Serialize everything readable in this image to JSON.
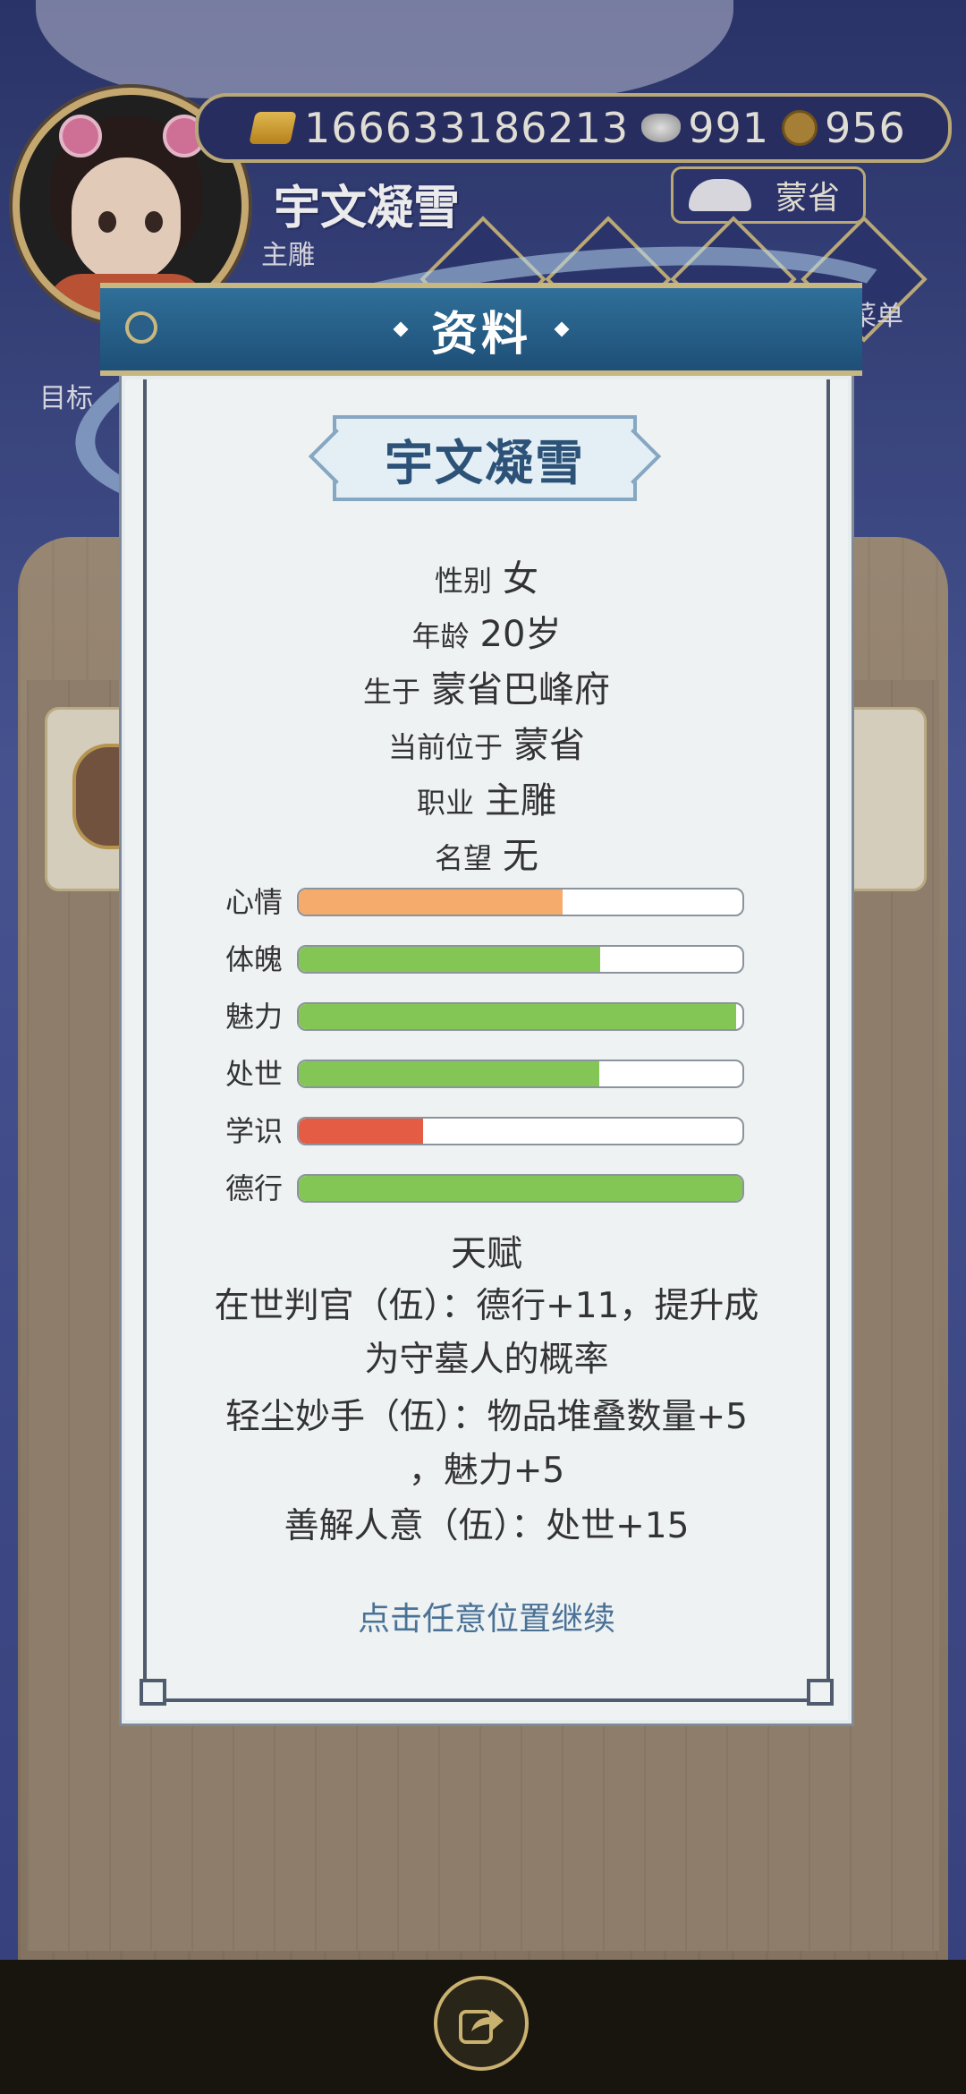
{
  "hud": {
    "gold": "166633186213",
    "silver": "991",
    "copper": "956",
    "name": "宇文凝雪",
    "job": "主雕",
    "location": "蒙省",
    "menu_label": "菜单",
    "target_label": "目标"
  },
  "panel": {
    "title": "资料",
    "name": "宇文凝雪",
    "info": [
      {
        "k": "性别",
        "v": "女"
      },
      {
        "k": "年龄",
        "v": "20岁"
      },
      {
        "k": "生于",
        "v": "蒙省巴峰府"
      },
      {
        "k": "当前位于",
        "v": "蒙省"
      },
      {
        "k": "职业",
        "v": "主雕"
      },
      {
        "k": "名望",
        "v": "无"
      }
    ],
    "stats": [
      {
        "label": "心情",
        "fraction": 0.595,
        "color": "#f4ab6c"
      },
      {
        "label": "体魄",
        "fraction": 0.68,
        "color": "#84c656"
      },
      {
        "label": "魅力",
        "fraction": 0.985,
        "color": "#84c656"
      },
      {
        "label": "处世",
        "fraction": 0.677,
        "color": "#84c656"
      },
      {
        "label": "学识",
        "fraction": 0.28,
        "color": "#e55c44"
      },
      {
        "label": "德行",
        "fraction": 1.0,
        "color": "#84c656"
      }
    ],
    "talent_title": "天赋",
    "talent_lines": [
      "在世判官（伍）：德行+11，提升成",
      "为守墓人的概率",
      "轻尘妙手（伍）：物品堆叠数量+5",
      "，魅力+5",
      "善解人意（伍）：处世+15"
    ],
    "continue_hint": "点击任意位置继续"
  }
}
